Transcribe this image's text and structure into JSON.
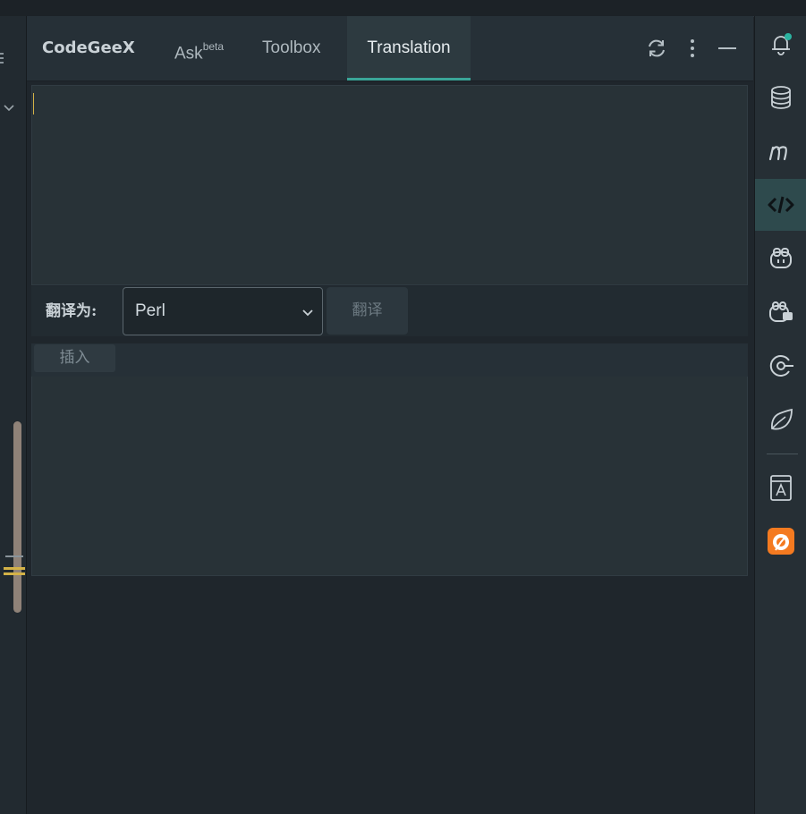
{
  "tabs": {
    "codegeex": "CodeGeeX",
    "ask": "Ask",
    "ask_sup": "beta",
    "toolbox": "Toolbox",
    "translation": "Translation",
    "active": "Translation"
  },
  "translate": {
    "label": "翻译为:",
    "selected_language": "Perl",
    "button_label": "翻译"
  },
  "output": {
    "insert_label": "插入"
  },
  "icons": {
    "header": [
      "refresh-icon",
      "more-vertical-icon",
      "minimize-icon"
    ],
    "right_strip": [
      "notification-bell-icon",
      "database-icon",
      "m-icon",
      "codegeex-icon",
      "copilot-icon",
      "copilot-chat-icon",
      "target-icon",
      "leaf-icon",
      "translate-book-icon",
      "orange-plugin-icon"
    ]
  },
  "colors": {
    "accent": "#3aa598",
    "notification_dot": "#2bb3a0",
    "caret": "#d4b247",
    "orange_plugin": "#f47a20"
  }
}
